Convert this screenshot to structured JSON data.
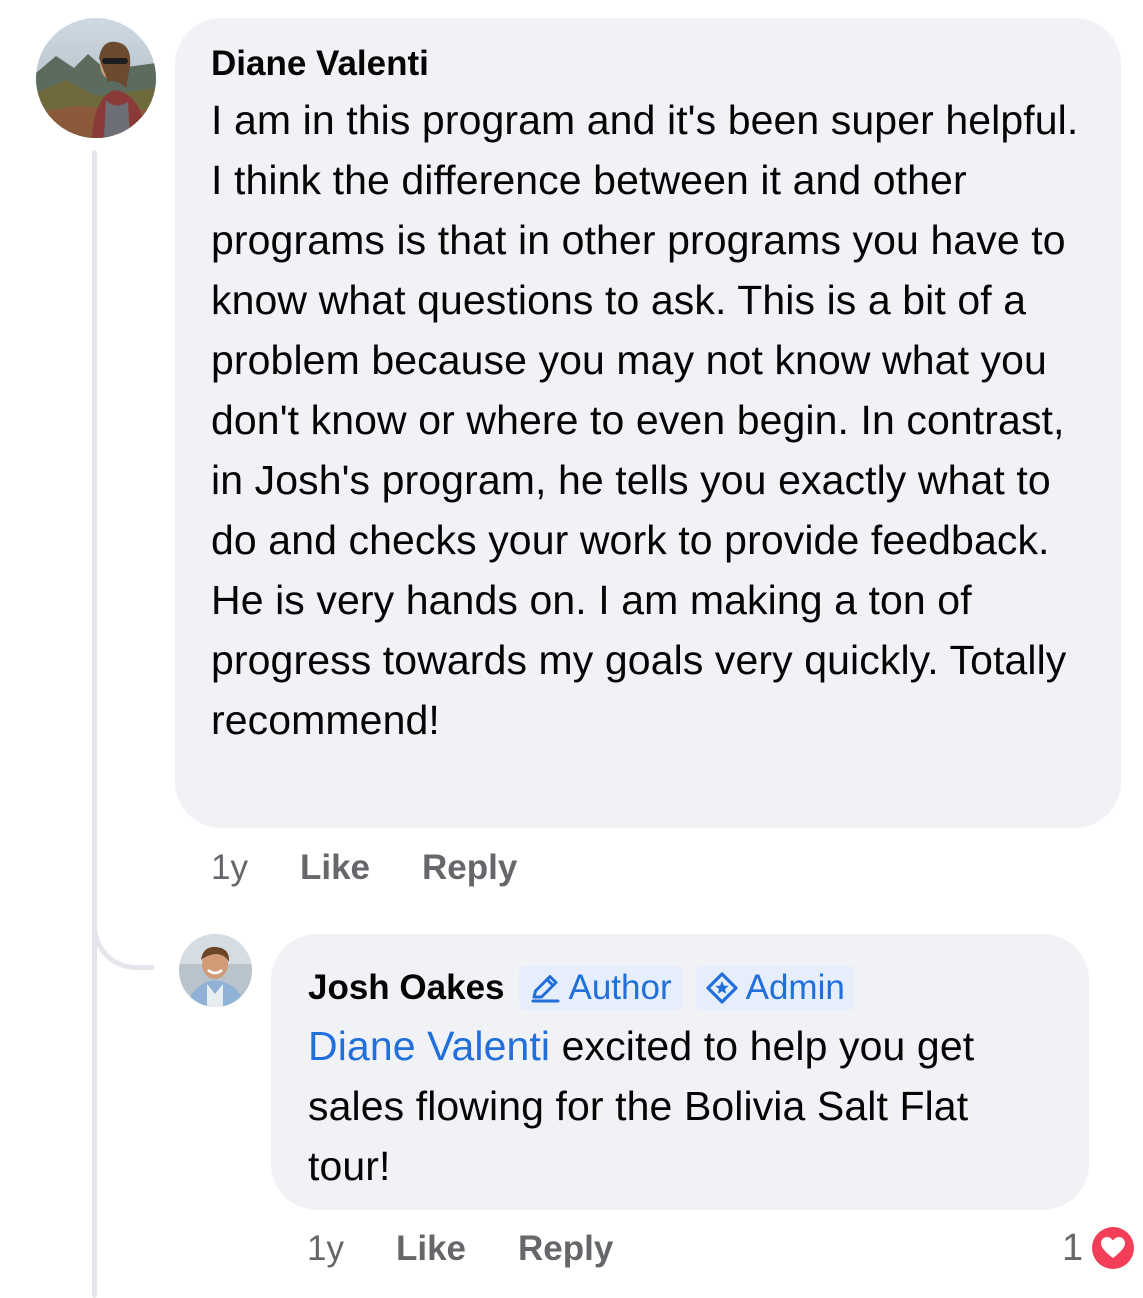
{
  "comments": {
    "diane": {
      "author": "Diane Valenti",
      "text": "I am in this program and it's been super helpful. I think the difference between it and other programs is that in other programs you have to know what questions to ask. This is a bit of a problem because you may not know what you don't know or where to even begin. In contrast, in Josh's program, he tells you exactly what to do and checks your work to provide feedback. He is very hands on. I am making a ton of progress towards my goals very quickly. Totally recommend!",
      "time": "1y",
      "like_label": "Like",
      "reply_label": "Reply"
    },
    "josh": {
      "author": "Josh Oakes",
      "badges": {
        "author_label": "Author",
        "admin_label": "Admin"
      },
      "mention": "Diane Valenti",
      "text": " excited to help you get sales flowing for the Bolivia Salt Flat tour!",
      "time": "1y",
      "like_label": "Like",
      "reply_label": "Reply",
      "reaction_count": "1",
      "reaction_icon": "love-heart-icon"
    }
  },
  "colors": {
    "bubble": "#f0f2f5",
    "link": "#216fdb",
    "meta": "#65676b",
    "love": "#f33e58"
  }
}
